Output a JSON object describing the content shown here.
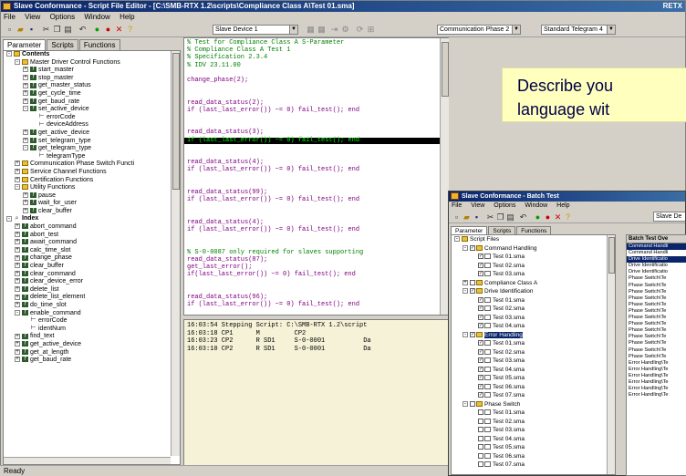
{
  "main": {
    "title": "Slave Conformance - Script File Editor - [C:\\SMB-RTX 1.2\\scripts\\Compliance Class A\\Test 01.sma]",
    "title_right": "RETX",
    "menu": [
      "File",
      "View",
      "Options",
      "Window",
      "Help"
    ],
    "combo_device": "Slave Device 1",
    "combo_phase": "Communication Phase 2",
    "combo_telegram": "Standard Telegram 4",
    "tabs": [
      "Parameter",
      "Scripts",
      "Functions"
    ],
    "tree": [
      {
        "level": 0,
        "pm": "-",
        "icon": "fold",
        "label": "Contents"
      },
      {
        "level": 1,
        "pm": "-",
        "icon": "fold",
        "label": "Master Driver Control Functions"
      },
      {
        "level": 2,
        "pm": "+",
        "icon": "fx",
        "label": "start_master"
      },
      {
        "level": 2,
        "pm": "+",
        "icon": "fx",
        "label": "stop_master"
      },
      {
        "level": 2,
        "pm": "+",
        "icon": "fx",
        "label": "get_master_status"
      },
      {
        "level": 2,
        "pm": "+",
        "icon": "fx",
        "label": "get_cycle_time"
      },
      {
        "level": 2,
        "pm": "+",
        "icon": "fx",
        "label": "get_baud_rate"
      },
      {
        "level": 2,
        "pm": "-",
        "icon": "fx",
        "label": "set_active_device"
      },
      {
        "level": 3,
        "pm": "",
        "icon": "param",
        "label": "errorCode"
      },
      {
        "level": 3,
        "pm": "",
        "icon": "param",
        "label": "deviceAddress"
      },
      {
        "level": 2,
        "pm": "+",
        "icon": "fx",
        "label": "get_active_device"
      },
      {
        "level": 2,
        "pm": "+",
        "icon": "fx",
        "label": "set_telegram_type"
      },
      {
        "level": 2,
        "pm": "-",
        "icon": "fx",
        "label": "get_telegram_type"
      },
      {
        "level": 3,
        "pm": "",
        "icon": "param",
        "label": "telegramType"
      },
      {
        "level": 1,
        "pm": "+",
        "icon": "fold",
        "label": "Communication Phase Switch Functi"
      },
      {
        "level": 1,
        "pm": "+",
        "icon": "fold",
        "label": "Service Channel Functions"
      },
      {
        "level": 1,
        "pm": "+",
        "icon": "fold",
        "label": "Certification Functions"
      },
      {
        "level": 1,
        "pm": "-",
        "icon": "fold",
        "label": "Utility Functions"
      },
      {
        "level": 2,
        "pm": "+",
        "icon": "fx",
        "label": "pause"
      },
      {
        "level": 2,
        "pm": "+",
        "icon": "fx",
        "label": "wait_for_user"
      },
      {
        "level": 2,
        "pm": "+",
        "icon": "fx",
        "label": "clear_buffer"
      },
      {
        "level": 0,
        "pm": "-",
        "icon": "search",
        "label": "Index"
      },
      {
        "level": 1,
        "pm": "+",
        "icon": "fx",
        "label": "abort_command"
      },
      {
        "level": 1,
        "pm": "+",
        "icon": "fx",
        "label": "abort_test"
      },
      {
        "level": 1,
        "pm": "+",
        "icon": "fx",
        "label": "await_command"
      },
      {
        "level": 1,
        "pm": "+",
        "icon": "fx",
        "label": "calc_time_slot"
      },
      {
        "level": 1,
        "pm": "+",
        "icon": "fx",
        "label": "change_phase"
      },
      {
        "level": 1,
        "pm": "+",
        "icon": "fx",
        "label": "clear_buffer"
      },
      {
        "level": 1,
        "pm": "+",
        "icon": "fx",
        "label": "clear_command"
      },
      {
        "level": 1,
        "pm": "+",
        "icon": "fx",
        "label": "clear_device_error"
      },
      {
        "level": 1,
        "pm": "+",
        "icon": "fx",
        "label": "delete_list"
      },
      {
        "level": 1,
        "pm": "+",
        "icon": "fx",
        "label": "delete_list_element"
      },
      {
        "level": 1,
        "pm": "+",
        "icon": "fx",
        "label": "do_time_slot"
      },
      {
        "level": 1,
        "pm": "-",
        "icon": "fx",
        "label": "enable_command"
      },
      {
        "level": 2,
        "pm": "",
        "icon": "param",
        "label": "errorCode"
      },
      {
        "level": 2,
        "pm": "",
        "icon": "param",
        "label": "identNum"
      },
      {
        "level": 1,
        "pm": "+",
        "icon": "fx",
        "label": "find_text"
      },
      {
        "level": 1,
        "pm": "+",
        "icon": "fx",
        "label": "get_active_device"
      },
      {
        "level": 1,
        "pm": "+",
        "icon": "fx",
        "label": "get_at_length"
      },
      {
        "level": 1,
        "pm": "+",
        "icon": "fx",
        "label": "get_baud_rate"
      }
    ],
    "code": [
      {
        "t": "comment",
        "s": "% Test for Compliance Class A S-Parameter"
      },
      {
        "t": "comment",
        "s": "% Compliance Class A Test 1"
      },
      {
        "t": "comment",
        "s": "% Specification 2.3.4"
      },
      {
        "t": "comment",
        "s": "% IDV 23.11.00"
      },
      {
        "t": "blank",
        "s": ""
      },
      {
        "t": "cmd",
        "s": "change_phase(2);"
      },
      {
        "t": "blank",
        "s": ""
      },
      {
        "t": "blank",
        "s": ""
      },
      {
        "t": "cmd",
        "s": "read_data_status(2);"
      },
      {
        "t": "cmd",
        "s": "if (last_last_error()) ~= 0) fail_test(); end"
      },
      {
        "t": "blank",
        "s": ""
      },
      {
        "t": "blank",
        "s": ""
      },
      {
        "t": "cmd",
        "s": "read_data_status(3);"
      },
      {
        "t": "hl",
        "s": "if (last_last_error()) ~= 0) fail_test(); end"
      },
      {
        "t": "blank",
        "s": ""
      },
      {
        "t": "blank",
        "s": ""
      },
      {
        "t": "cmd",
        "s": "read_data_status(4);"
      },
      {
        "t": "cmd",
        "s": "if (last_last_error()) ~= 0) fail_test(); end"
      },
      {
        "t": "blank",
        "s": ""
      },
      {
        "t": "blank",
        "s": ""
      },
      {
        "t": "cmd",
        "s": "read_data_status(99);"
      },
      {
        "t": "cmd",
        "s": "if (last_last_error()) ~= 0) fail_test(); end"
      },
      {
        "t": "blank",
        "s": ""
      },
      {
        "t": "blank",
        "s": ""
      },
      {
        "t": "cmd",
        "s": "read_data_status(4);"
      },
      {
        "t": "cmd",
        "s": "if (last_last_error()) ~= 0) fail_test(); end"
      },
      {
        "t": "blank",
        "s": ""
      },
      {
        "t": "blank",
        "s": ""
      },
      {
        "t": "comment",
        "s": "% S-0-0087 only required for slaves supporting"
      },
      {
        "t": "cmd",
        "s": "read_data_status(87);"
      },
      {
        "t": "cmd",
        "s": "get_last_error();"
      },
      {
        "t": "cmd",
        "s": "if(last_last_error()) ~= 0) fail_test(); end"
      },
      {
        "t": "blank",
        "s": ""
      },
      {
        "t": "blank",
        "s": ""
      },
      {
        "t": "cmd",
        "s": "read_data_status(96);"
      },
      {
        "t": "cmd",
        "s": "if (last_last_error()) ~= 0) fail_test(); end"
      }
    ],
    "log": [
      "16:03:54 Stepping Script: C:\\SMB-RTX 1.2\\script",
      "16:03:18 CP1      M         CP2",
      "16:03:23 CP2      R SD1     S-0-0001          Da",
      "16:03:10 CP2      R SD1     S-0-0001          Da"
    ],
    "status": "Ready"
  },
  "callout": {
    "line1": "Describe you",
    "line2": "language wit"
  },
  "batch": {
    "title": "Slave Conformance - Batch Test",
    "menu": [
      "File",
      "View",
      "Options",
      "Window",
      "Help"
    ],
    "combo": "Slave De",
    "tabs": [
      "Parameter",
      "Scripts",
      "Functions"
    ],
    "list_header": "Batch Test Ove",
    "tree": [
      {
        "level": 0,
        "pm": "-",
        "icon": "fold",
        "label": "Script Files"
      },
      {
        "level": 1,
        "pm": "-",
        "icon": "fold",
        "label": "Command Handling",
        "chk": true
      },
      {
        "level": 2,
        "icon": "scr",
        "label": "Test 01.sma",
        "chk": true
      },
      {
        "level": 2,
        "icon": "scr",
        "label": "Test 02.sma",
        "chk": true
      },
      {
        "level": 2,
        "icon": "scr",
        "label": "Test 03.sma",
        "chk": true
      },
      {
        "level": 1,
        "pm": "+",
        "icon": "fold",
        "label": "Compliance Class A",
        "chk": false
      },
      {
        "level": 1,
        "pm": "-",
        "icon": "fold",
        "label": "Drive Identification",
        "chk": true
      },
      {
        "level": 2,
        "icon": "scr",
        "label": "Test 01.sma",
        "chk": true
      },
      {
        "level": 2,
        "icon": "scr",
        "label": "Test 02.sma",
        "chk": true
      },
      {
        "level": 2,
        "icon": "scr",
        "label": "Test 03.sma",
        "chk": true
      },
      {
        "level": 2,
        "icon": "scr",
        "label": "Test 04.sma",
        "chk": true
      },
      {
        "level": 1,
        "pm": "-",
        "icon": "fold",
        "label": "Error Handling",
        "chk": true,
        "sel": true
      },
      {
        "level": 2,
        "icon": "scr",
        "label": "Test 01.sma",
        "chk": true
      },
      {
        "level": 2,
        "icon": "scr",
        "label": "Test 02.sma",
        "chk": true
      },
      {
        "level": 2,
        "icon": "scr",
        "label": "Test 03.sma",
        "chk": true
      },
      {
        "level": 2,
        "icon": "scr",
        "label": "Test 04.sma",
        "chk": true
      },
      {
        "level": 2,
        "icon": "scr",
        "label": "Test 05.sma",
        "chk": true
      },
      {
        "level": 2,
        "icon": "scr",
        "label": "Test 06.sma",
        "chk": true
      },
      {
        "level": 2,
        "icon": "scr",
        "label": "Test 07.sma",
        "chk": true
      },
      {
        "level": 1,
        "pm": "-",
        "icon": "fold",
        "label": "Phase Switch",
        "chk": false
      },
      {
        "level": 2,
        "icon": "scr",
        "label": "Test 01.sma",
        "chk": false
      },
      {
        "level": 2,
        "icon": "scr",
        "label": "Test 02.sma",
        "chk": false
      },
      {
        "level": 2,
        "icon": "scr",
        "label": "Test 03.sma",
        "chk": false
      },
      {
        "level": 2,
        "icon": "scr",
        "label": "Test 04.sma",
        "chk": false
      },
      {
        "level": 2,
        "icon": "scr",
        "label": "Test 05.sma",
        "chk": false
      },
      {
        "level": 2,
        "icon": "scr",
        "label": "Test 06.sma",
        "chk": false
      },
      {
        "level": 2,
        "icon": "scr",
        "label": "Test 07.sma",
        "chk": false
      }
    ],
    "list": [
      {
        "label": "Command Handli",
        "sel": true
      },
      {
        "label": "Command Handli",
        "sel": false
      },
      {
        "label": "Drive Identificatio",
        "sel": true
      },
      {
        "label": "Drive Identificatio",
        "sel": false
      },
      {
        "label": "Drive Identificatio",
        "sel": false
      },
      {
        "label": "Phase Switch\\Te",
        "sel": false
      },
      {
        "label": "Phase Switch\\Te",
        "sel": false
      },
      {
        "label": "Phase Switch\\Te",
        "sel": false
      },
      {
        "label": "Phase Switch\\Te",
        "sel": false
      },
      {
        "label": "Phase Switch\\Te",
        "sel": false
      },
      {
        "label": "Phase Switch\\Te",
        "sel": false
      },
      {
        "label": "Phase Switch\\Te",
        "sel": false
      },
      {
        "label": "Phase Switch\\Te",
        "sel": false
      },
      {
        "label": "Phase Switch\\Te",
        "sel": false
      },
      {
        "label": "Phase Switch\\Te",
        "sel": false
      },
      {
        "label": "Phase Switch\\Te",
        "sel": false
      },
      {
        "label": "Phase Switch\\Te",
        "sel": false
      },
      {
        "label": "Phase Switch\\Te",
        "sel": false
      },
      {
        "label": "Error Handling\\Te",
        "sel": false
      },
      {
        "label": "Error Handling\\Te",
        "sel": false
      },
      {
        "label": "Error Handling\\Te",
        "sel": false
      },
      {
        "label": "Error Handling\\Te",
        "sel": false
      },
      {
        "label": "Error Handling\\Te",
        "sel": false
      },
      {
        "label": "Error Handling\\Te",
        "sel": false
      }
    ]
  },
  "colors": {
    "title_bar": "#0a246a",
    "comment": "#008000",
    "command": "#800080",
    "highlight_bg": "#000000",
    "highlight_fg": "#00ff00",
    "callout_bg": "#ffffbe",
    "log_bg": "#f5f2d8"
  }
}
